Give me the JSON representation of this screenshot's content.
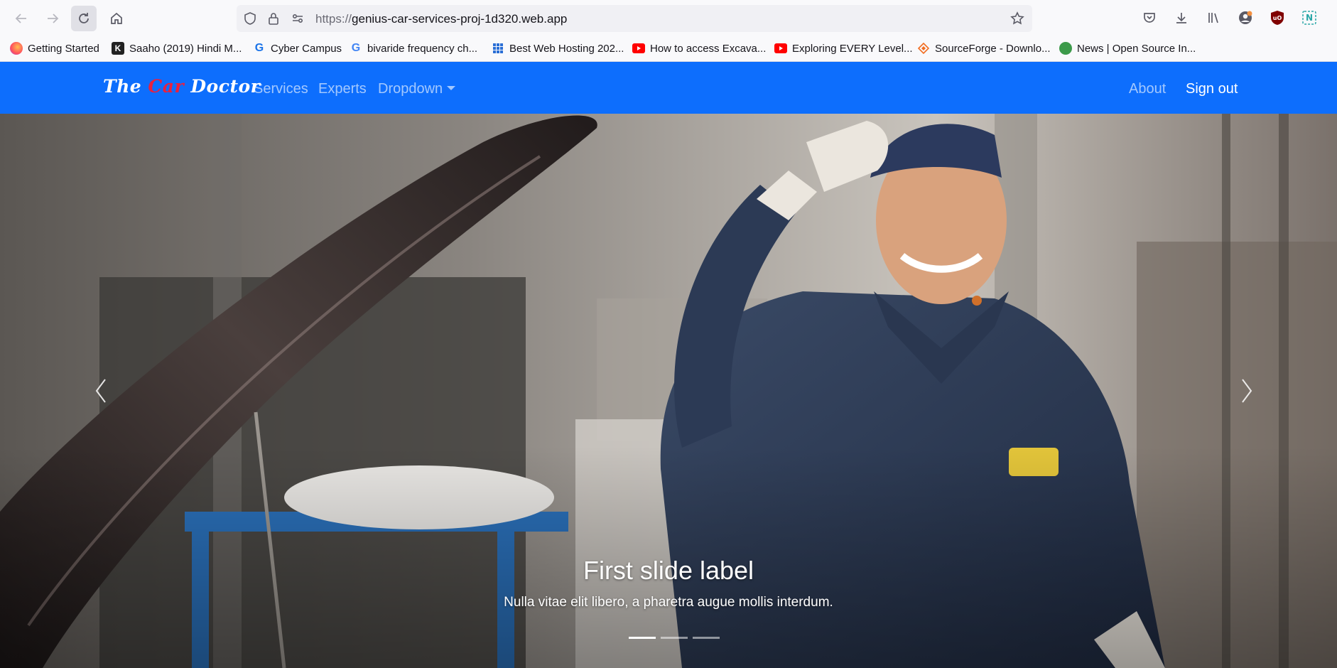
{
  "browser": {
    "url_scheme": "https://",
    "url_host": "genius-car-services-proj-1d320.web.app"
  },
  "bookmarks": [
    {
      "label": "Getting Started",
      "icon": "firefox-icon"
    },
    {
      "label": "Saaho (2019) Hindi M...",
      "icon": "k-logo-icon"
    },
    {
      "label": "Cyber Campus",
      "icon": "cyber-campus-icon"
    },
    {
      "label": "bivaride frequency ch...",
      "icon": "google-icon"
    },
    {
      "label": "Best Web Hosting 202...",
      "icon": "grid-icon"
    },
    {
      "label": "How to access Excava...",
      "icon": "youtube-icon"
    },
    {
      "label": "Exploring EVERY Level...",
      "icon": "youtube-icon"
    },
    {
      "label": "SourceForge - Downlo...",
      "icon": "sourceforge-icon"
    },
    {
      "label": "News | Open Source In...",
      "icon": "news-icon"
    }
  ],
  "navbar": {
    "brand_the": "The ",
    "brand_car": "Car",
    "brand_doctor": " Doctor",
    "services": "Services",
    "experts": "Experts",
    "dropdown": "Dropdown",
    "about": "About",
    "sign_out": "Sign out",
    "bg_color": "#0d6efd"
  },
  "carousel": {
    "title": "First slide label",
    "text": "Nulla vitae elit libero, a pharetra augue mollis interdum.",
    "active_index": 0,
    "slide_count": 3
  }
}
